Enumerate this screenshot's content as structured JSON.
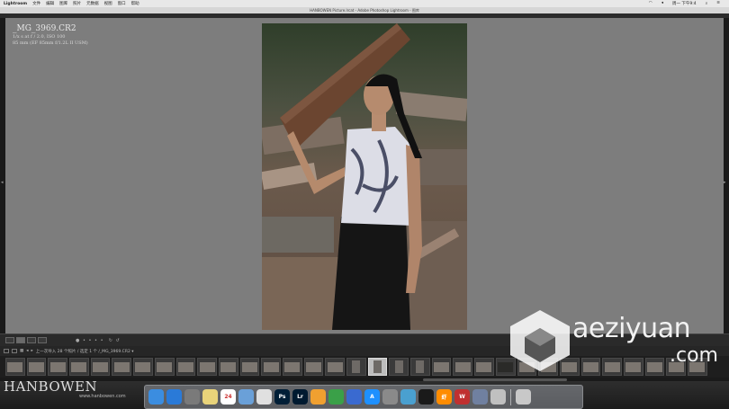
{
  "menubar": {
    "app": "Lightroom",
    "items": [
      "文件",
      "编辑",
      "图库",
      "照片",
      "元数据",
      "视图",
      "窗口",
      "帮助"
    ],
    "right_time": "周一 下午9:4"
  },
  "window_title": "HANBOWEN Picture.lrcat - Adobe Photoshop Lightroom - 图库",
  "photo_info": {
    "filename": "_MG_3969.CR2",
    "exposure": "1/x s at f / 2.0, ISO 100",
    "lens": "85 mm (EF 85mm f/1.2L II USM)"
  },
  "filmstrip": {
    "header_text": "上一次导入  28 个照片 / 选定 1 个 /_MG_3969.CR2 ▾",
    "selected_index": 17,
    "count": 33
  },
  "watermark": {
    "brand": "aeziyuan",
    "tld": ".com",
    "author": "HANBOWEN",
    "author_url": "www.hanbowen.com"
  },
  "dock": {
    "calendar_day": "24",
    "icons": [
      "finder-icon",
      "safari-icon",
      "launchpad-icon",
      "notes-icon",
      "calendar-icon",
      "preview-icon",
      "photos-icon",
      "photoshop-icon",
      "lightroom-icon",
      "pages-icon",
      "numbers-icon",
      "keynote-icon",
      "appstore-icon",
      "settings-icon",
      "instruments-icon",
      "qq-icon",
      "xiami-icon",
      "wps-icon",
      "rocket-icon",
      "screenshot-icon",
      "trash-icon"
    ]
  },
  "colors": {
    "loupe_bg": "#7d7d7d",
    "panel_bg": "#2a2a2a"
  }
}
